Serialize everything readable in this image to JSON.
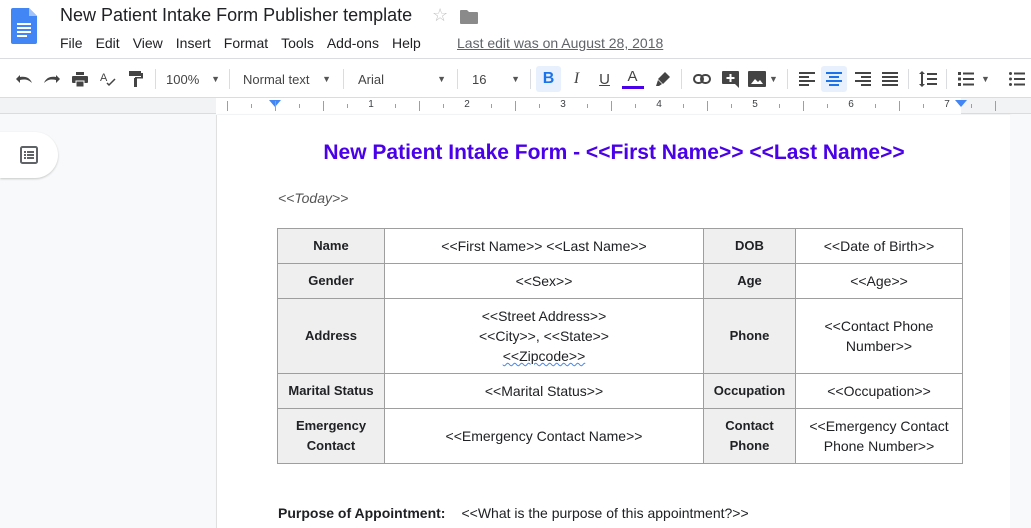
{
  "app": {
    "doc_title": "New Patient Intake Form Publisher template",
    "last_edit": "Last edit was on August 28, 2018",
    "menu": [
      "File",
      "Edit",
      "View",
      "Insert",
      "Format",
      "Tools",
      "Add-ons",
      "Help"
    ]
  },
  "toolbar": {
    "zoom": "100%",
    "style": "Normal text",
    "font": "Arial",
    "font_size": "16",
    "text_color": "#4a00e8",
    "active": [
      "bold",
      "align-center"
    ]
  },
  "ruler": {
    "labels": [
      "1",
      "2",
      "3",
      "4",
      "5",
      "6",
      "7"
    ]
  },
  "document": {
    "heading": "New Patient Intake Form - <<First Name>> <<Last Name>>",
    "heading_color": "#4a00e8",
    "today": "<<Today>>",
    "table": {
      "rows": [
        {
          "l1": "Name",
          "v1": [
            "<<First Name>> <<Last Name>>"
          ],
          "l2": [
            "DOB"
          ],
          "v2": [
            "<<Date of Birth>>"
          ]
        },
        {
          "l1": "Gender",
          "v1": [
            "<<Sex>>"
          ],
          "l2": [
            "Age"
          ],
          "v2": [
            "<<Age>>"
          ]
        },
        {
          "l1": "Address",
          "v1": [
            "<<Street Address>>",
            "<<City>>, <<State>>",
            "<<Zipcode>>"
          ],
          "l2": [
            "Phone"
          ],
          "v2": [
            "<<Contact Phone",
            "Number>>"
          ]
        },
        {
          "l1": "Marital Status",
          "v1": [
            "<<Marital Status>>"
          ],
          "l2": [
            "Occupation"
          ],
          "v2": [
            "<<Occupation>>"
          ]
        },
        {
          "l1": "Emergency Contact",
          "v1": [
            "<<Emergency Contact Name>>"
          ],
          "l2": [
            "Contact",
            "Phone"
          ],
          "v2": [
            "<<Emergency Contact",
            "Phone Number>>"
          ]
        }
      ]
    },
    "purpose_label": "Purpose of Appointment:",
    "purpose_value": "<<What is the purpose of this appointment?>>"
  }
}
